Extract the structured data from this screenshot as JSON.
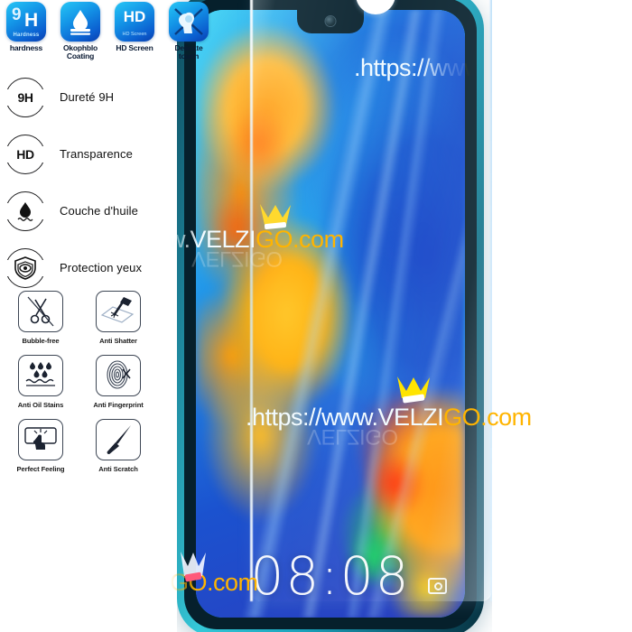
{
  "product": {
    "brand_watermark": "VELZIGO",
    "watermark_prefix": ".https://www.",
    "watermark_suffix": ".com",
    "watermark_full": ".https://www.VELZIGO.com",
    "accent_orange": "#ffb400",
    "accent_cyan": "#24d3f3",
    "badge_blue": "#1497e8"
  },
  "watermarks": {
    "top": {
      "white": ".https://ww",
      "orange": "w"
    },
    "middle": {
      "white": "w.VELZI",
      "orange": "GO.com"
    },
    "lower": {
      "white": ".https://www.VELZI",
      "orange": "GO.com"
    },
    "bottom": {
      "white": "",
      "orange": "GO.com"
    },
    "ghost": "VELZIGO"
  },
  "feature_badges": [
    {
      "icon": "hardness-9h-icon",
      "badge_top": "9",
      "badge_main": "H",
      "badge_caption": "Hardness",
      "label": "hardness"
    },
    {
      "icon": "oleophobic-coating-icon",
      "badge_caption": "",
      "label": "Okophblo Coating"
    },
    {
      "icon": "hd-screen-icon",
      "badge_main": "HD",
      "badge_caption": "HD Screen",
      "label": "HD Screen"
    },
    {
      "icon": "delicate-touch-icon",
      "badge_caption": "",
      "label": "Delicate touch"
    }
  ],
  "bullets": [
    {
      "icon": "hardness-ring-icon",
      "ring_text": "9H",
      "label": "Dureté 9H"
    },
    {
      "icon": "hd-ring-icon",
      "ring_text": "HD",
      "label": "Transparence"
    },
    {
      "icon": "oil-drop-ring-icon",
      "ring_text": "",
      "label": "Couche d'huile"
    },
    {
      "icon": "eye-shield-ring-icon",
      "ring_text": "",
      "label": "Protection yeux"
    }
  ],
  "grid_features": [
    {
      "icon": "scissors-bubble-icon",
      "label": "Bubble-free"
    },
    {
      "icon": "hammer-shatter-icon",
      "label": "Anti Shatter"
    },
    {
      "icon": "oil-stains-icon",
      "label": "Anti Oil Stains"
    },
    {
      "icon": "fingerprint-icon",
      "label": "Anti Fingerprint"
    },
    {
      "icon": "perfect-feeling-icon",
      "label": "Perfect Feeling"
    },
    {
      "icon": "knife-scratch-icon",
      "label": "Anti Scratch"
    }
  ],
  "phone": {
    "lock_time": "08:08",
    "lock_date": "",
    "camera_shortcut": "camera-icon"
  }
}
